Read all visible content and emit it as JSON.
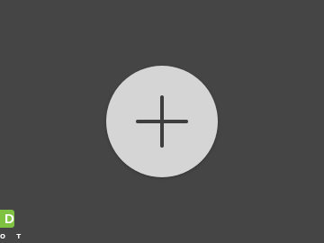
{
  "colors": {
    "background": "#454545",
    "button_fill": "#d5d5d5",
    "icon_stroke": "#3e3e3e",
    "logo_green": "#7fc242",
    "logo_letter": "#ffffff"
  },
  "add_button": {
    "icon": "plus-icon"
  },
  "logo": {
    "letter": "D",
    "subtext": "O T"
  }
}
